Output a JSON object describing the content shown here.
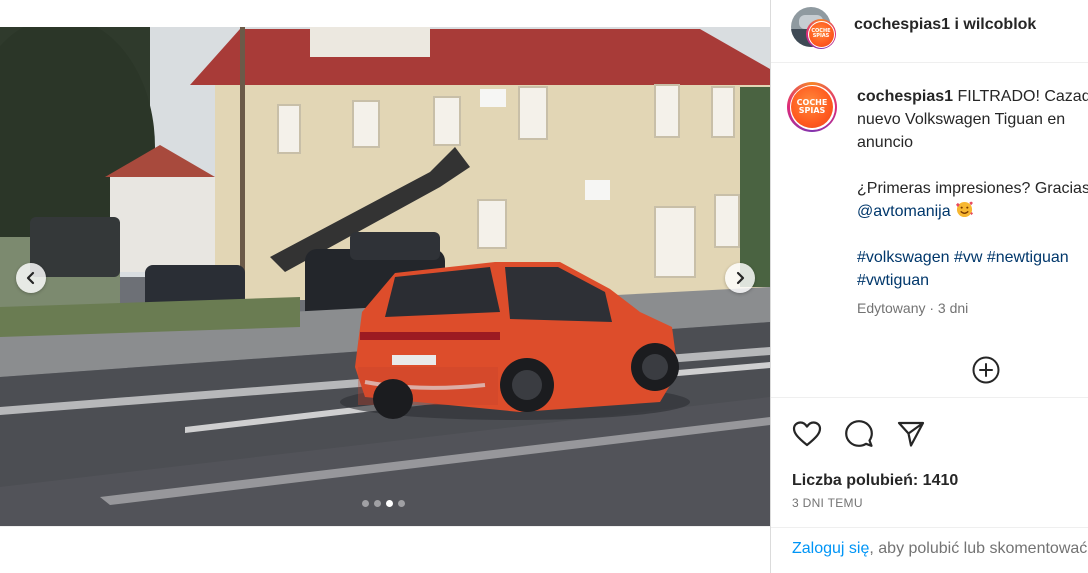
{
  "header": {
    "author": "cochespias1",
    "separator": " i ",
    "coauthor": "wilcoblok"
  },
  "logo": {
    "line1": "COCHE",
    "line2": "SPIAS"
  },
  "caption": {
    "username": "cochespias1",
    "line1": "FILTRADO! Cazado",
    "line2": "nuevo Volkswagen Tiguan en",
    "line3": "anuncio",
    "line4": "¿Primeras impresiones? Gracias",
    "mention": "@avtomanija",
    "hashtag_line1": "#volkswagen #vw #newtiguan",
    "hashtag_line2": "#vwtiguan",
    "edited": "Edytowany · 3 dni"
  },
  "carousel": {
    "slide_count": 4,
    "active_index": 2
  },
  "engagement": {
    "likes_label": "Liczba polubień:",
    "likes_count": "1410",
    "time_ago": "3 DNI TEMU"
  },
  "login_prompt": {
    "login_link": "Zaloguj się",
    "rest": ", aby polubić lub skomentować."
  },
  "icons": [
    "chevron-left-icon",
    "chevron-right-icon",
    "add-circle-icon",
    "heart-icon",
    "comment-icon",
    "share-icon",
    "smiling-face-with-hearts-emoji"
  ],
  "colors": {
    "link": "#00376b",
    "login": "#0095f6",
    "muted": "#737373",
    "car": "#e0502e"
  }
}
